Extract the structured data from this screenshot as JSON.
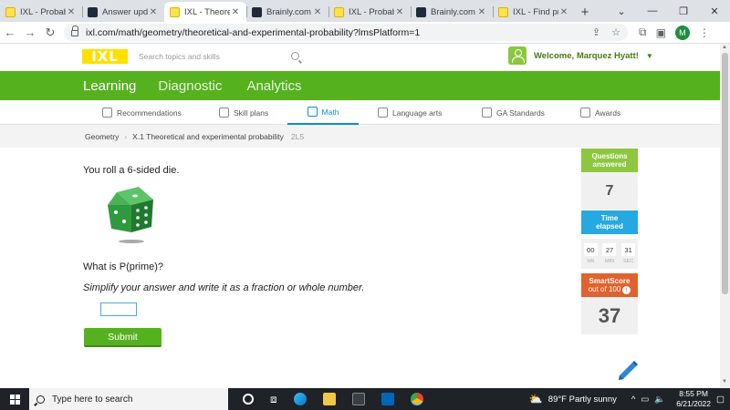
{
  "browser": {
    "tabs": [
      {
        "title": "IXL - Probabilit",
        "icon": "ixl-favicon",
        "active": false
      },
      {
        "title": "Answer updat",
        "icon": "brainly-favicon",
        "active": false
      },
      {
        "title": "IXL - Theoretic",
        "icon": "ixl-favicon",
        "active": true
      },
      {
        "title": "Brainly.com - F",
        "icon": "brainly-favicon",
        "active": false
      },
      {
        "title": "IXL - Probabilit",
        "icon": "ixl-favicon",
        "active": false
      },
      {
        "title": "Brainly.com - F",
        "icon": "brainly-favicon",
        "active": false
      },
      {
        "title": "IXL - Find prob",
        "icon": "ixl-favicon",
        "active": false
      }
    ],
    "url": "ixl.com/math/geometry/theoretical-and-experimental-probability?lmsPlatform=1",
    "profile_initial": "M"
  },
  "ixl": {
    "logo": "IXL",
    "search_placeholder": "Search topics and skills",
    "welcome": "Welcome, Marquez Hyatt!",
    "nav": [
      "Learning",
      "Diagnostic",
      "Analytics"
    ],
    "subnav": [
      "Recommendations",
      "Skill plans",
      "Math",
      "Language arts",
      "GA Standards",
      "Awards"
    ],
    "breadcrumb": {
      "subject": "Geometry",
      "skill": "X.1 Theoretical and experimental probability",
      "code": "2L5"
    }
  },
  "question": {
    "intro": "You roll a 6-sided die.",
    "prompt": "What is P(prime)?",
    "instruction": "Simplify your answer and write it as a fraction or whole number.",
    "answer_value": "",
    "submit_label": "Submit"
  },
  "stats": {
    "questions_label_1": "Questions",
    "questions_label_2": "answered",
    "questions_value": "7",
    "time_label_1": "Time",
    "time_label_2": "elapsed",
    "time": [
      {
        "v": "00",
        "l": "HR"
      },
      {
        "v": "27",
        "l": "MIN"
      },
      {
        "v": "31",
        "l": "SEC"
      }
    ],
    "smartscore_label": "SmartScore",
    "smartscore_sub": "out of 100",
    "smartscore_value": "37",
    "colors": {
      "questions": "#8dc63f",
      "time": "#26a9e0",
      "smartscore": "#e0622c"
    }
  },
  "taskbar": {
    "search_placeholder": "Type here to search",
    "weather": "89°F  Partly sunny",
    "time": "8:55 PM",
    "date": "6/21/2022"
  }
}
